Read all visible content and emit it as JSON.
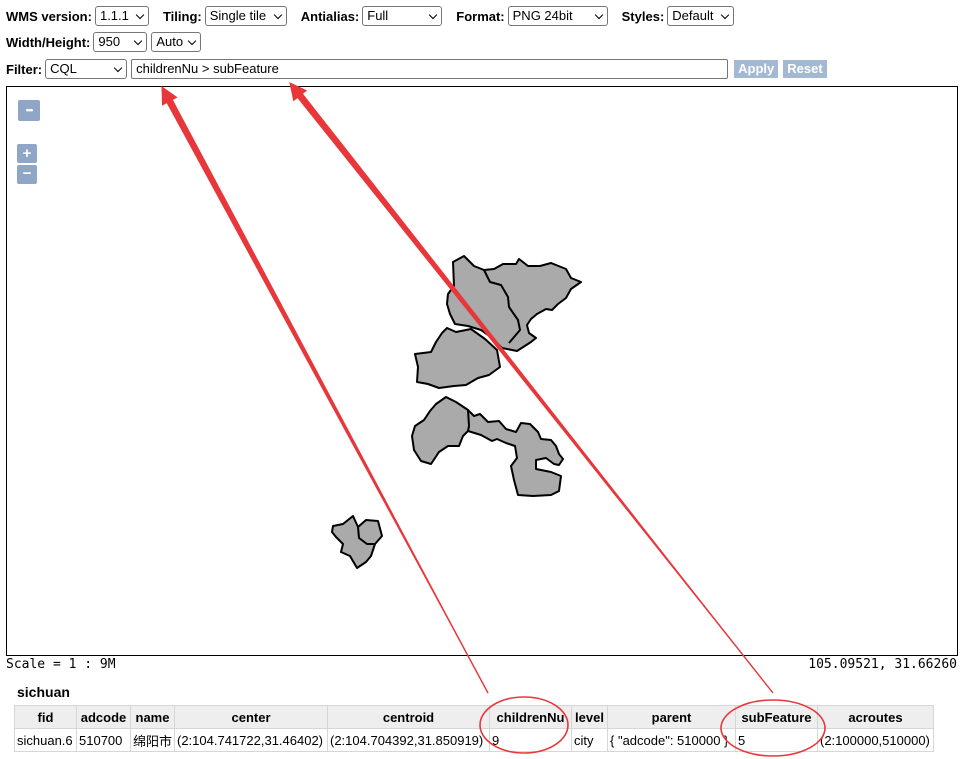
{
  "toolbar": {
    "wms_label": "WMS version:",
    "wms_value": "1.1.1",
    "tiling_label": "Tiling:",
    "tiling_value": "Single tile",
    "antialias_label": "Antialias:",
    "antialias_value": "Full",
    "format_label": "Format:",
    "format_value": "PNG 24bit",
    "styles_label": "Styles:",
    "styles_value": "Default",
    "wh_label": "Width/Height:",
    "width_value": "950",
    "height_value": "Auto",
    "filter_label": "Filter:",
    "filter_type": "CQL",
    "filter_text": "childrenNu > subFeature",
    "apply_label": "Apply",
    "reset_label": "Reset"
  },
  "map": {
    "controls": {
      "more": "•••",
      "zoom_in": "+",
      "zoom_out": "−"
    },
    "scale": "Scale = 1 : 9M",
    "coords": "105.09521, 31.66260",
    "feature_fill": "#aaaaaa"
  },
  "results": {
    "layer_title": "sichuan",
    "columns": [
      "fid",
      "adcode",
      "name",
      "center",
      "centroid",
      "childrenNu",
      "level",
      "parent",
      "subFeature",
      "acroutes"
    ],
    "rows": [
      [
        "sichuan.6",
        "510700",
        "绵阳市",
        "(2:104.741722,31.46402)",
        "(2:104.704392,31.850919)",
        "9",
        "city",
        "{ \"adcode\": 510000 }",
        "5",
        "(2:100000,510000)"
      ]
    ]
  },
  "annotation_color": "#e8373a"
}
